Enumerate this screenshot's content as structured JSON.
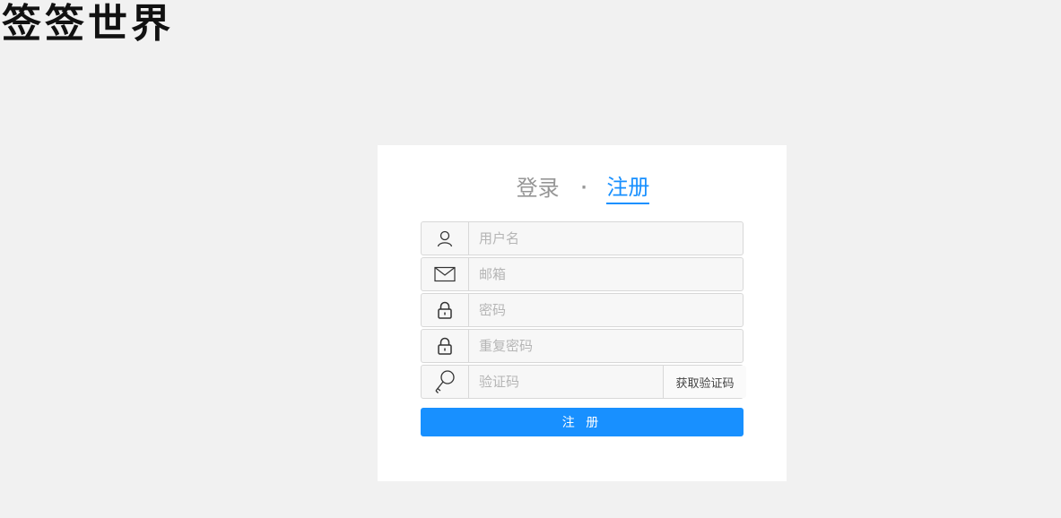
{
  "logo": {
    "text": "签签世界"
  },
  "tabs": {
    "login": "登录",
    "separator": "·",
    "register": "注册"
  },
  "form": {
    "username": {
      "placeholder": "用户名",
      "icon": "user-icon"
    },
    "email": {
      "placeholder": "邮箱",
      "icon": "mail-icon"
    },
    "password": {
      "placeholder": "密码",
      "icon": "lock-icon"
    },
    "confirm_password": {
      "placeholder": "重复密码",
      "icon": "lock-icon"
    },
    "code": {
      "placeholder": "验证码",
      "icon": "key-icon",
      "button": "获取验证码"
    },
    "submit": "注 册"
  },
  "colors": {
    "accent": "#1890ff",
    "background": "#f1f1f1",
    "card": "#ffffff"
  }
}
